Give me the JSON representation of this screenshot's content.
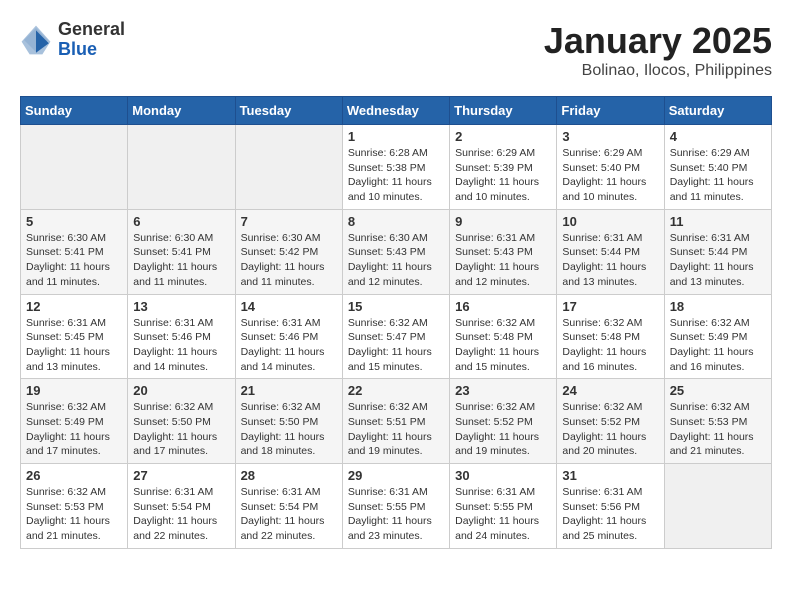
{
  "header": {
    "logo_general": "General",
    "logo_blue": "Blue",
    "month_title": "January 2025",
    "location": "Bolinao, Ilocos, Philippines"
  },
  "days_of_week": [
    "Sunday",
    "Monday",
    "Tuesday",
    "Wednesday",
    "Thursday",
    "Friday",
    "Saturday"
  ],
  "weeks": [
    [
      {
        "day": "",
        "info": ""
      },
      {
        "day": "",
        "info": ""
      },
      {
        "day": "",
        "info": ""
      },
      {
        "day": "1",
        "info": "Sunrise: 6:28 AM\nSunset: 5:38 PM\nDaylight: 11 hours\nand 10 minutes."
      },
      {
        "day": "2",
        "info": "Sunrise: 6:29 AM\nSunset: 5:39 PM\nDaylight: 11 hours\nand 10 minutes."
      },
      {
        "day": "3",
        "info": "Sunrise: 6:29 AM\nSunset: 5:40 PM\nDaylight: 11 hours\nand 10 minutes."
      },
      {
        "day": "4",
        "info": "Sunrise: 6:29 AM\nSunset: 5:40 PM\nDaylight: 11 hours\nand 11 minutes."
      }
    ],
    [
      {
        "day": "5",
        "info": "Sunrise: 6:30 AM\nSunset: 5:41 PM\nDaylight: 11 hours\nand 11 minutes."
      },
      {
        "day": "6",
        "info": "Sunrise: 6:30 AM\nSunset: 5:41 PM\nDaylight: 11 hours\nand 11 minutes."
      },
      {
        "day": "7",
        "info": "Sunrise: 6:30 AM\nSunset: 5:42 PM\nDaylight: 11 hours\nand 11 minutes."
      },
      {
        "day": "8",
        "info": "Sunrise: 6:30 AM\nSunset: 5:43 PM\nDaylight: 11 hours\nand 12 minutes."
      },
      {
        "day": "9",
        "info": "Sunrise: 6:31 AM\nSunset: 5:43 PM\nDaylight: 11 hours\nand 12 minutes."
      },
      {
        "day": "10",
        "info": "Sunrise: 6:31 AM\nSunset: 5:44 PM\nDaylight: 11 hours\nand 13 minutes."
      },
      {
        "day": "11",
        "info": "Sunrise: 6:31 AM\nSunset: 5:44 PM\nDaylight: 11 hours\nand 13 minutes."
      }
    ],
    [
      {
        "day": "12",
        "info": "Sunrise: 6:31 AM\nSunset: 5:45 PM\nDaylight: 11 hours\nand 13 minutes."
      },
      {
        "day": "13",
        "info": "Sunrise: 6:31 AM\nSunset: 5:46 PM\nDaylight: 11 hours\nand 14 minutes."
      },
      {
        "day": "14",
        "info": "Sunrise: 6:31 AM\nSunset: 5:46 PM\nDaylight: 11 hours\nand 14 minutes."
      },
      {
        "day": "15",
        "info": "Sunrise: 6:32 AM\nSunset: 5:47 PM\nDaylight: 11 hours\nand 15 minutes."
      },
      {
        "day": "16",
        "info": "Sunrise: 6:32 AM\nSunset: 5:48 PM\nDaylight: 11 hours\nand 15 minutes."
      },
      {
        "day": "17",
        "info": "Sunrise: 6:32 AM\nSunset: 5:48 PM\nDaylight: 11 hours\nand 16 minutes."
      },
      {
        "day": "18",
        "info": "Sunrise: 6:32 AM\nSunset: 5:49 PM\nDaylight: 11 hours\nand 16 minutes."
      }
    ],
    [
      {
        "day": "19",
        "info": "Sunrise: 6:32 AM\nSunset: 5:49 PM\nDaylight: 11 hours\nand 17 minutes."
      },
      {
        "day": "20",
        "info": "Sunrise: 6:32 AM\nSunset: 5:50 PM\nDaylight: 11 hours\nand 17 minutes."
      },
      {
        "day": "21",
        "info": "Sunrise: 6:32 AM\nSunset: 5:50 PM\nDaylight: 11 hours\nand 18 minutes."
      },
      {
        "day": "22",
        "info": "Sunrise: 6:32 AM\nSunset: 5:51 PM\nDaylight: 11 hours\nand 19 minutes."
      },
      {
        "day": "23",
        "info": "Sunrise: 6:32 AM\nSunset: 5:52 PM\nDaylight: 11 hours\nand 19 minutes."
      },
      {
        "day": "24",
        "info": "Sunrise: 6:32 AM\nSunset: 5:52 PM\nDaylight: 11 hours\nand 20 minutes."
      },
      {
        "day": "25",
        "info": "Sunrise: 6:32 AM\nSunset: 5:53 PM\nDaylight: 11 hours\nand 21 minutes."
      }
    ],
    [
      {
        "day": "26",
        "info": "Sunrise: 6:32 AM\nSunset: 5:53 PM\nDaylight: 11 hours\nand 21 minutes."
      },
      {
        "day": "27",
        "info": "Sunrise: 6:31 AM\nSunset: 5:54 PM\nDaylight: 11 hours\nand 22 minutes."
      },
      {
        "day": "28",
        "info": "Sunrise: 6:31 AM\nSunset: 5:54 PM\nDaylight: 11 hours\nand 22 minutes."
      },
      {
        "day": "29",
        "info": "Sunrise: 6:31 AM\nSunset: 5:55 PM\nDaylight: 11 hours\nand 23 minutes."
      },
      {
        "day": "30",
        "info": "Sunrise: 6:31 AM\nSunset: 5:55 PM\nDaylight: 11 hours\nand 24 minutes."
      },
      {
        "day": "31",
        "info": "Sunrise: 6:31 AM\nSunset: 5:56 PM\nDaylight: 11 hours\nand 25 minutes."
      },
      {
        "day": "",
        "info": ""
      }
    ]
  ]
}
